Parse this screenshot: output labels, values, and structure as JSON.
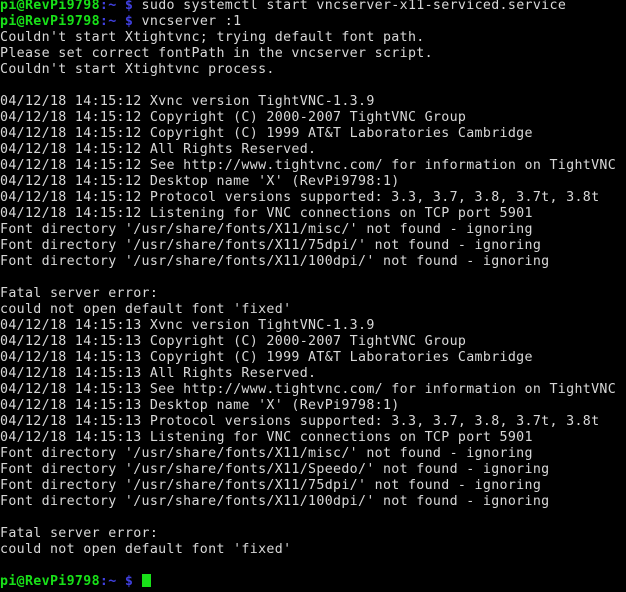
{
  "window": {
    "title": "pi@RevPi9798: ~",
    "background_color": "#000000",
    "foreground_color": "#d8d8d8",
    "prompt_user_color": "#18e018",
    "prompt_path_color": "#4040e0",
    "cursor_color": "#19e019"
  },
  "prompt": {
    "user_host": "pi@RevPi9798",
    "path": ":~",
    "symbol": "$"
  },
  "session": {
    "commands": [
      "sudo systemctl start vncserver-x11-serviced.service",
      "vncserver :1"
    ],
    "lines": [
      {
        "type": "prompt",
        "command": "sudo systemctl start vncserver-x11-serviced.service"
      },
      {
        "type": "prompt",
        "command": "vncserver :1"
      },
      {
        "type": "output",
        "text": "Couldn't start Xtightvnc; trying default font path."
      },
      {
        "type": "output",
        "text": "Please set correct fontPath in the vncserver script."
      },
      {
        "type": "output",
        "text": "Couldn't start Xtightvnc process."
      },
      {
        "type": "blank",
        "text": ""
      },
      {
        "type": "output",
        "text": "04/12/18 14:15:12 Xvnc version TightVNC-1.3.9"
      },
      {
        "type": "output",
        "text": "04/12/18 14:15:12 Copyright (C) 2000-2007 TightVNC Group"
      },
      {
        "type": "output",
        "text": "04/12/18 14:15:12 Copyright (C) 1999 AT&T Laboratories Cambridge"
      },
      {
        "type": "output",
        "text": "04/12/18 14:15:12 All Rights Reserved."
      },
      {
        "type": "output",
        "text": "04/12/18 14:15:12 See http://www.tightvnc.com/ for information on TightVNC"
      },
      {
        "type": "output",
        "text": "04/12/18 14:15:12 Desktop name 'X' (RevPi9798:1)"
      },
      {
        "type": "output",
        "text": "04/12/18 14:15:12 Protocol versions supported: 3.3, 3.7, 3.8, 3.7t, 3.8t"
      },
      {
        "type": "output",
        "text": "04/12/18 14:15:12 Listening for VNC connections on TCP port 5901"
      },
      {
        "type": "output",
        "text": "Font directory '/usr/share/fonts/X11/misc/' not found - ignoring"
      },
      {
        "type": "output",
        "text": "Font directory '/usr/share/fonts/X11/75dpi/' not found - ignoring"
      },
      {
        "type": "output",
        "text": "Font directory '/usr/share/fonts/X11/100dpi/' not found - ignoring"
      },
      {
        "type": "blank",
        "text": ""
      },
      {
        "type": "output",
        "text": "Fatal server error:"
      },
      {
        "type": "output",
        "text": "could not open default font 'fixed'"
      },
      {
        "type": "output",
        "text": "04/12/18 14:15:13 Xvnc version TightVNC-1.3.9"
      },
      {
        "type": "output",
        "text": "04/12/18 14:15:13 Copyright (C) 2000-2007 TightVNC Group"
      },
      {
        "type": "output",
        "text": "04/12/18 14:15:13 Copyright (C) 1999 AT&T Laboratories Cambridge"
      },
      {
        "type": "output",
        "text": "04/12/18 14:15:13 All Rights Reserved."
      },
      {
        "type": "output",
        "text": "04/12/18 14:15:13 See http://www.tightvnc.com/ for information on TightVNC"
      },
      {
        "type": "output",
        "text": "04/12/18 14:15:13 Desktop name 'X' (RevPi9798:1)"
      },
      {
        "type": "output",
        "text": "04/12/18 14:15:13 Protocol versions supported: 3.3, 3.7, 3.8, 3.7t, 3.8t"
      },
      {
        "type": "output",
        "text": "04/12/18 14:15:13 Listening for VNC connections on TCP port 5901"
      },
      {
        "type": "output",
        "text": "Font directory '/usr/share/fonts/X11/misc/' not found - ignoring"
      },
      {
        "type": "output",
        "text": "Font directory '/usr/share/fonts/X11/Speedo/' not found - ignoring"
      },
      {
        "type": "output",
        "text": "Font directory '/usr/share/fonts/X11/75dpi/' not found - ignoring"
      },
      {
        "type": "output",
        "text": "Font directory '/usr/share/fonts/X11/100dpi/' not found - ignoring"
      },
      {
        "type": "blank",
        "text": ""
      },
      {
        "type": "output",
        "text": "Fatal server error:"
      },
      {
        "type": "output",
        "text": "could not open default font 'fixed'"
      },
      {
        "type": "blank",
        "text": ""
      },
      {
        "type": "prompt",
        "command": "",
        "cursor": true
      }
    ]
  }
}
